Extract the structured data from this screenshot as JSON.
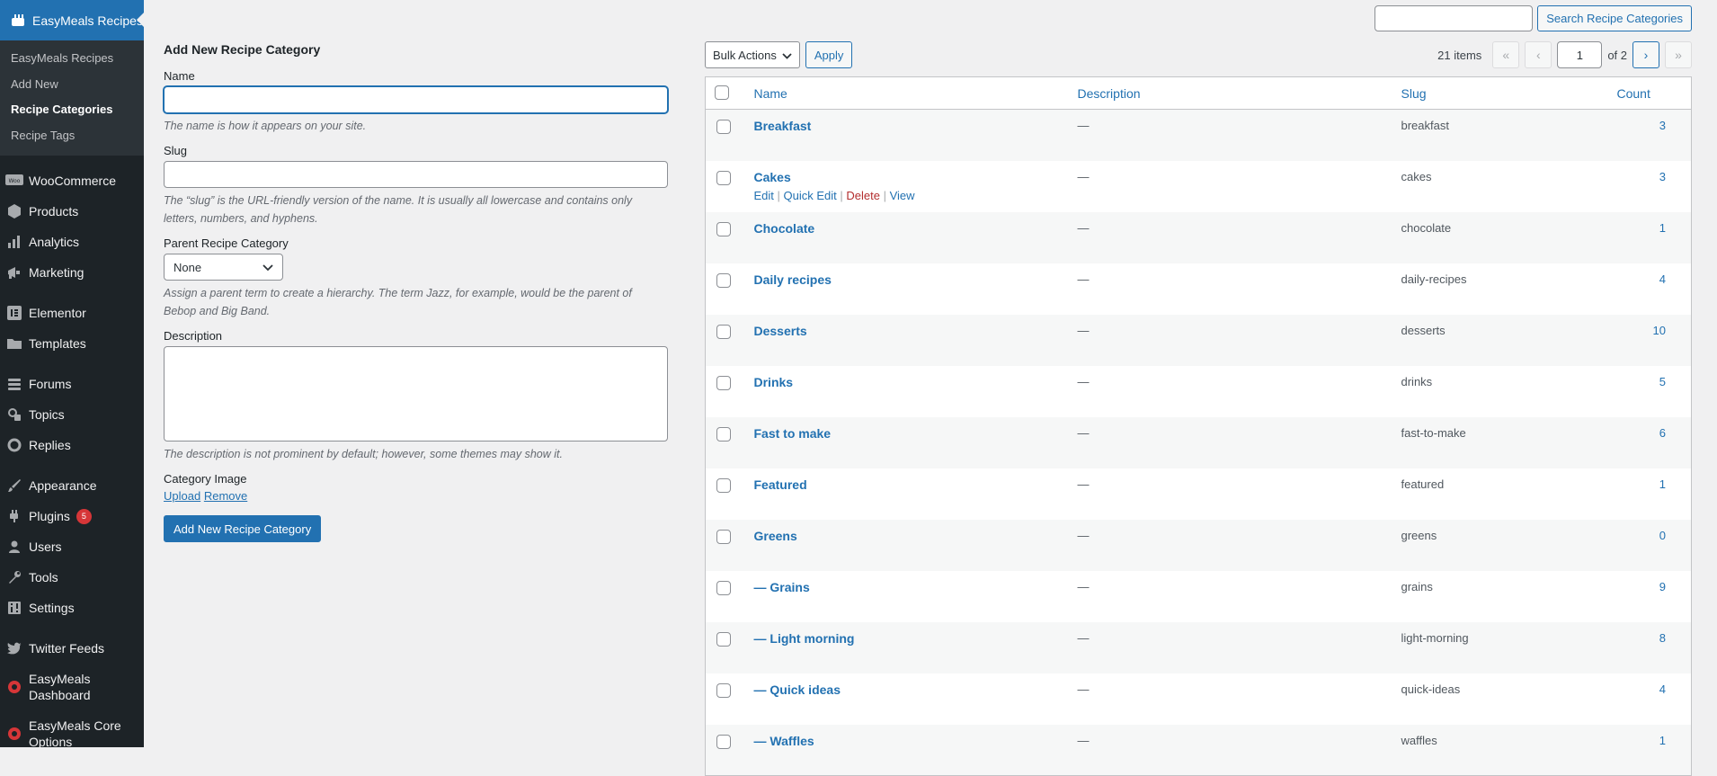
{
  "sidebar": {
    "current": {
      "label": "EasyMeals Recipes",
      "icon": "easymeals-icon"
    },
    "submenu": [
      {
        "label": "EasyMeals Recipes",
        "active": false
      },
      {
        "label": "Add New",
        "active": false
      },
      {
        "label": "Recipe Categories",
        "active": true
      },
      {
        "label": "Recipe Tags",
        "active": false
      }
    ],
    "items": [
      {
        "label": "WooCommerce",
        "icon": "woocommerce-icon"
      },
      {
        "label": "Products",
        "icon": "products-icon"
      },
      {
        "label": "Analytics",
        "icon": "analytics-icon"
      },
      {
        "label": "Marketing",
        "icon": "marketing-icon"
      },
      {
        "label": "Elementor",
        "icon": "elementor-icon"
      },
      {
        "label": "Templates",
        "icon": "templates-icon"
      },
      {
        "label": "Forums",
        "icon": "forums-icon"
      },
      {
        "label": "Topics",
        "icon": "topics-icon"
      },
      {
        "label": "Replies",
        "icon": "replies-icon"
      },
      {
        "label": "Appearance",
        "icon": "appearance-icon"
      },
      {
        "label": "Plugins",
        "icon": "plugins-icon",
        "badge": "5"
      },
      {
        "label": "Users",
        "icon": "users-icon"
      },
      {
        "label": "Tools",
        "icon": "tools-icon"
      },
      {
        "label": "Settings",
        "icon": "settings-icon"
      },
      {
        "label": "Twitter Feeds",
        "icon": "twitter-icon"
      },
      {
        "label": "EasyMeals Dashboard",
        "icon": "easymeals-dashboard-icon"
      },
      {
        "label": "EasyMeals Core Options",
        "icon": "easymeals-core-icon"
      }
    ]
  },
  "search": {
    "button_label": "Search Recipe Categories",
    "value": ""
  },
  "form": {
    "heading": "Add New Recipe Category",
    "name_label": "Name",
    "name_value": "",
    "name_help": "The name is how it appears on your site.",
    "slug_label": "Slug",
    "slug_value": "",
    "slug_help": "The “slug” is the URL-friendly version of the name. It is usually all lowercase and contains only letters, numbers, and hyphens.",
    "parent_label": "Parent Recipe Category",
    "parent_value": "None",
    "parent_help": "Assign a parent term to create a hierarchy. The term Jazz, for example, would be the parent of Bebop and Big Band.",
    "description_label": "Description",
    "description_help": "The description is not prominent by default; however, some themes may show it.",
    "image_label": "Category Image",
    "upload_label": "Upload",
    "remove_label": "Remove",
    "submit_label": "Add New Recipe Category"
  },
  "tablenav": {
    "bulk_actions": "Bulk Actions",
    "apply_label": "Apply",
    "items_count": "21 items",
    "first": "«",
    "prev": "‹",
    "current_page": "1",
    "of_pages": "of 2",
    "next": "›",
    "last": "»"
  },
  "table": {
    "columns": {
      "name": "Name",
      "description": "Description",
      "slug": "Slug",
      "count": "Count"
    },
    "row_actions": {
      "edit": "Edit",
      "quick_edit": "Quick Edit",
      "delete": "Delete",
      "view": "View"
    },
    "rows": [
      {
        "name": "Breakfast",
        "description": "—",
        "slug": "breakfast",
        "count": "3"
      },
      {
        "name": "Cakes",
        "description": "—",
        "slug": "cakes",
        "count": "3",
        "show_actions": true
      },
      {
        "name": "Chocolate",
        "description": "—",
        "slug": "chocolate",
        "count": "1"
      },
      {
        "name": "Daily recipes",
        "description": "—",
        "slug": "daily-recipes",
        "count": "4"
      },
      {
        "name": "Desserts",
        "description": "—",
        "slug": "desserts",
        "count": "10"
      },
      {
        "name": "Drinks",
        "description": "—",
        "slug": "drinks",
        "count": "5"
      },
      {
        "name": "Fast to make",
        "description": "—",
        "slug": "fast-to-make",
        "count": "6"
      },
      {
        "name": "Featured",
        "description": "—",
        "slug": "featured",
        "count": "1"
      },
      {
        "name": "Greens",
        "description": "—",
        "slug": "greens",
        "count": "0"
      },
      {
        "name": "— Grains",
        "description": "—",
        "slug": "grains",
        "count": "9"
      },
      {
        "name": "— Light morning",
        "description": "—",
        "slug": "light-morning",
        "count": "8"
      },
      {
        "name": "— Quick ideas",
        "description": "—",
        "slug": "quick-ideas",
        "count": "4"
      },
      {
        "name": "— Waffles",
        "description": "—",
        "slug": "waffles",
        "count": "1"
      }
    ]
  },
  "colors": {
    "accent": "#2271b1",
    "sidebar_bg": "#1d2327",
    "submenu_bg": "#2c3338",
    "badge": "#d63638"
  }
}
